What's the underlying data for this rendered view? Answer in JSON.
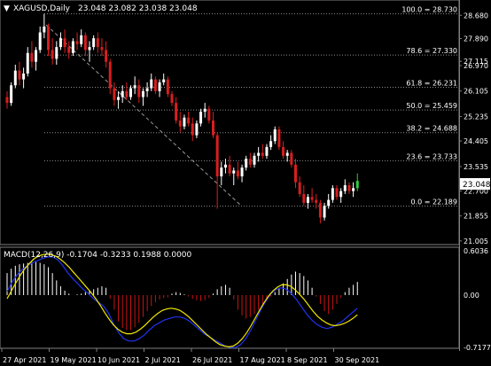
{
  "header": {
    "arrow_glyph": "▼",
    "symbol": "XAGUSD,Daily",
    "ohlc": "23.048 23.082 23.038 23.048"
  },
  "colors": {
    "background": "#000000",
    "grid": "#7f7f7f",
    "text": "#ffffff",
    "bull": "#ffffff",
    "bear": "#d81e1e",
    "price_label_bg": "#ffffff",
    "price_label_text": "#000000",
    "macd_hist_up": "#ffffff",
    "macd_hist_down": "#c81414",
    "macd_line": "#2233ee",
    "signal_line": "#f0e600",
    "last_candle": "#2ecc40"
  },
  "price_panel": {
    "price_axis_ticks": [
      "28.680",
      "27.890",
      "27.115",
      "26.970",
      "26.105",
      "25.235",
      "24.405",
      "23.535",
      "22.700",
      "21.855",
      "21.005"
    ],
    "last_price_label": "23.048"
  },
  "macd_panel": {
    "label": "MACD(12,26,9) -0.1704 -0.3233 0.1988 0.0000",
    "axis_ticks": [
      "0.6036",
      "0.00",
      "-0.7177"
    ]
  },
  "x_axis_labels": [
    "27 Apr 2021",
    "19 May 2021",
    "10 Jun 2021",
    "2 Jul 2021",
    "26 Jul 2021",
    "17 Aug 2021",
    "8 Sep 2021",
    "30 Sep 2021"
  ],
  "chart_data": {
    "type": "candlestick",
    "symbol": "XAGUSD",
    "timeframe": "Daily",
    "ylim": [
      21.0,
      28.9
    ],
    "fibonacci_levels": [
      {
        "label": "100.0 = 28.730",
        "value": 28.73
      },
      {
        "label": "78.6 = 27.330",
        "value": 27.33
      },
      {
        "label": "61.8 = 26.231",
        "value": 26.231
      },
      {
        "label": "50.0 = 25.459",
        "value": 25.459
      },
      {
        "label": "38.2 = 24.688",
        "value": 24.688
      },
      {
        "label": "23.6 = 23.733",
        "value": 23.733
      },
      {
        "label": "0.0 = 22.189",
        "value": 22.189
      }
    ],
    "candles": [
      [
        25.9,
        26.1,
        25.5,
        25.7
      ],
      [
        25.7,
        26.4,
        25.6,
        26.3
      ],
      [
        26.3,
        27.0,
        26.2,
        26.8
      ],
      [
        26.8,
        27.1,
        26.3,
        26.5
      ],
      [
        26.5,
        26.9,
        26.2,
        26.7
      ],
      [
        26.7,
        27.6,
        26.6,
        27.4
      ],
      [
        27.4,
        27.8,
        26.9,
        27.1
      ],
      [
        27.1,
        27.6,
        26.8,
        27.5
      ],
      [
        27.5,
        28.3,
        27.4,
        28.1
      ],
      [
        28.1,
        28.73,
        27.9,
        28.3
      ],
      [
        28.3,
        28.4,
        27.3,
        27.5
      ],
      [
        27.5,
        27.9,
        27.0,
        27.2
      ],
      [
        27.2,
        27.8,
        27.0,
        27.6
      ],
      [
        27.6,
        28.1,
        27.5,
        27.9
      ],
      [
        27.9,
        28.2,
        27.4,
        27.6
      ],
      [
        27.6,
        27.8,
        27.2,
        27.4
      ],
      [
        27.4,
        27.9,
        27.3,
        27.8
      ],
      [
        27.8,
        28.1,
        27.5,
        27.7
      ],
      [
        27.7,
        28.2,
        27.6,
        28.0
      ],
      [
        28.0,
        28.1,
        27.3,
        27.5
      ],
      [
        27.5,
        27.8,
        27.1,
        27.6
      ],
      [
        27.6,
        28.0,
        27.5,
        27.9
      ],
      [
        27.9,
        28.1,
        27.4,
        27.6
      ],
      [
        27.6,
        27.9,
        27.3,
        27.5
      ],
      [
        27.5,
        27.8,
        26.9,
        27.1
      ],
      [
        27.1,
        27.2,
        26.0,
        26.2
      ],
      [
        26.2,
        26.4,
        25.6,
        25.8
      ],
      [
        25.8,
        26.1,
        25.5,
        25.9
      ],
      [
        25.9,
        26.3,
        25.7,
        26.1
      ],
      [
        26.1,
        26.4,
        25.8,
        25.9
      ],
      [
        25.9,
        26.3,
        25.8,
        26.2
      ],
      [
        26.2,
        26.6,
        26.0,
        26.3
      ],
      [
        26.3,
        26.5,
        25.7,
        25.9
      ],
      [
        25.9,
        26.2,
        25.6,
        26.1
      ],
      [
        26.1,
        26.4,
        25.9,
        26.2
      ],
      [
        26.2,
        26.7,
        26.1,
        26.5
      ],
      [
        26.5,
        26.6,
        26.0,
        26.1
      ],
      [
        26.1,
        26.5,
        25.9,
        26.4
      ],
      [
        26.4,
        26.7,
        26.3,
        26.5
      ],
      [
        26.5,
        26.6,
        25.9,
        26.0
      ],
      [
        26.0,
        26.1,
        25.6,
        25.7
      ],
      [
        25.7,
        25.9,
        25.0,
        25.1
      ],
      [
        25.1,
        25.4,
        24.7,
        24.9
      ],
      [
        24.9,
        25.3,
        24.8,
        25.2
      ],
      [
        25.2,
        25.4,
        24.9,
        25.0
      ],
      [
        25.0,
        25.2,
        24.4,
        24.6
      ],
      [
        24.6,
        25.1,
        24.5,
        25.0
      ],
      [
        25.0,
        25.5,
        24.9,
        25.4
      ],
      [
        25.4,
        25.7,
        25.2,
        25.5
      ],
      [
        25.5,
        25.6,
        25.0,
        25.1
      ],
      [
        25.1,
        25.4,
        24.5,
        24.6
      ],
      [
        24.6,
        24.7,
        22.1,
        23.2
      ],
      [
        23.2,
        23.7,
        22.9,
        23.5
      ],
      [
        23.5,
        23.8,
        23.3,
        23.6
      ],
      [
        23.6,
        23.9,
        23.2,
        23.3
      ],
      [
        23.3,
        23.5,
        22.9,
        23.4
      ],
      [
        23.4,
        23.7,
        23.1,
        23.2
      ],
      [
        23.2,
        23.6,
        23.0,
        23.5
      ],
      [
        23.5,
        23.9,
        23.4,
        23.8
      ],
      [
        23.8,
        24.0,
        23.5,
        23.6
      ],
      [
        23.6,
        24.0,
        23.5,
        23.9
      ],
      [
        23.9,
        24.2,
        23.7,
        24.0
      ],
      [
        24.0,
        24.3,
        23.8,
        23.9
      ],
      [
        23.9,
        24.3,
        23.8,
        24.2
      ],
      [
        24.2,
        24.6,
        24.1,
        24.4
      ],
      [
        24.4,
        24.9,
        24.3,
        24.8
      ],
      [
        24.8,
        24.9,
        24.1,
        24.2
      ],
      [
        24.2,
        24.4,
        23.8,
        23.9
      ],
      [
        23.9,
        24.1,
        23.7,
        24.0
      ],
      [
        24.0,
        24.1,
        23.5,
        23.6
      ],
      [
        23.6,
        23.8,
        22.8,
        23.0
      ],
      [
        23.0,
        23.2,
        22.5,
        22.6
      ],
      [
        22.6,
        22.9,
        22.2,
        22.3
      ],
      [
        22.3,
        22.6,
        22.1,
        22.5
      ],
      [
        22.5,
        22.8,
        22.3,
        22.4
      ],
      [
        22.4,
        22.6,
        22.1,
        22.3
      ],
      [
        22.3,
        22.4,
        21.6,
        21.8
      ],
      [
        21.8,
        22.3,
        21.7,
        22.2
      ],
      [
        22.2,
        22.6,
        22.1,
        22.4
      ],
      [
        22.4,
        22.9,
        22.3,
        22.8
      ],
      [
        22.8,
        22.9,
        22.4,
        22.5
      ],
      [
        22.5,
        22.8,
        22.3,
        22.7
      ],
      [
        22.7,
        23.1,
        22.6,
        22.9
      ],
      [
        22.9,
        23.0,
        22.6,
        22.7
      ],
      [
        22.7,
        23.0,
        22.5,
        22.8
      ],
      [
        22.8,
        23.3,
        22.7,
        23.048
      ]
    ],
    "macd_histogram": [
      0.3,
      0.36,
      0.4,
      0.42,
      0.43,
      0.44,
      0.45,
      0.45,
      0.44,
      0.42,
      0.38,
      0.3,
      0.2,
      0.12,
      0.06,
      0.02,
      0.0,
      0.01,
      0.02,
      0.04,
      0.06,
      0.08,
      0.1,
      0.12,
      0.1,
      -0.05,
      -0.2,
      -0.36,
      -0.45,
      -0.48,
      -0.48,
      -0.44,
      -0.38,
      -0.3,
      -0.22,
      -0.15,
      -0.1,
      -0.06,
      -0.04,
      -0.03,
      0.02,
      0.04,
      0.03,
      0.01,
      -0.02,
      -0.05,
      -0.07,
      -0.08,
      -0.07,
      -0.04,
      0.02,
      0.08,
      0.12,
      0.14,
      0.1,
      -0.06,
      -0.2,
      -0.28,
      -0.32,
      -0.3,
      -0.26,
      -0.2,
      -0.14,
      -0.08,
      -0.02,
      0.04,
      0.1,
      0.16,
      0.22,
      0.28,
      0.32,
      0.3,
      0.26,
      0.2,
      0.1,
      -0.02,
      -0.12,
      -0.22,
      -0.26,
      -0.2,
      -0.12,
      -0.04,
      0.04,
      0.1,
      0.14,
      0.18
    ],
    "macd_signal": [
      -0.05,
      0.06,
      0.17,
      0.27,
      0.36,
      0.43,
      0.49,
      0.53,
      0.55,
      0.56,
      0.55,
      0.53,
      0.49,
      0.44,
      0.38,
      0.31,
      0.24,
      0.17,
      0.1,
      0.03,
      -0.05,
      -0.14,
      -0.24,
      -0.33,
      -0.41,
      -0.47,
      -0.51,
      -0.53,
      -0.53,
      -0.51,
      -0.47,
      -0.42,
      -0.36,
      -0.3,
      -0.25,
      -0.21,
      -0.19,
      -0.18,
      -0.19,
      -0.21,
      -0.25,
      -0.3,
      -0.36,
      -0.42,
      -0.48,
      -0.54,
      -0.59,
      -0.64,
      -0.68,
      -0.7,
      -0.71,
      -0.7,
      -0.66,
      -0.6,
      -0.52,
      -0.42,
      -0.31,
      -0.2,
      -0.1,
      -0.01,
      0.06,
      0.11,
      0.14,
      0.14,
      0.12,
      0.07,
      0.01,
      -0.06,
      -0.14,
      -0.22,
      -0.29,
      -0.34,
      -0.38,
      -0.41,
      -0.42,
      -0.41,
      -0.39,
      -0.36,
      -0.32,
      -0.27
    ],
    "macd_line": [
      0.05,
      0.18,
      0.28,
      0.35,
      0.4,
      0.44,
      0.47,
      0.5,
      0.52,
      0.52,
      0.48,
      0.4,
      0.3,
      0.22,
      0.15,
      0.08,
      0.02,
      -0.05,
      -0.1,
      -0.15,
      -0.25,
      -0.4,
      -0.52,
      -0.6,
      -0.63,
      -0.63,
      -0.6,
      -0.55,
      -0.48,
      -0.42,
      -0.38,
      -0.34,
      -0.32,
      -0.3,
      -0.3,
      -0.32,
      -0.36,
      -0.42,
      -0.48,
      -0.54,
      -0.58,
      -0.62,
      -0.66,
      -0.7,
      -0.72,
      -0.72,
      -0.68,
      -0.6,
      -0.48,
      -0.34,
      -0.2,
      -0.08,
      0.02,
      0.08,
      0.1,
      0.08,
      0.02,
      -0.06,
      -0.16,
      -0.26,
      -0.34,
      -0.4,
      -0.44,
      -0.46,
      -0.44,
      -0.4,
      -0.36,
      -0.3,
      -0.24,
      -0.18
    ]
  }
}
